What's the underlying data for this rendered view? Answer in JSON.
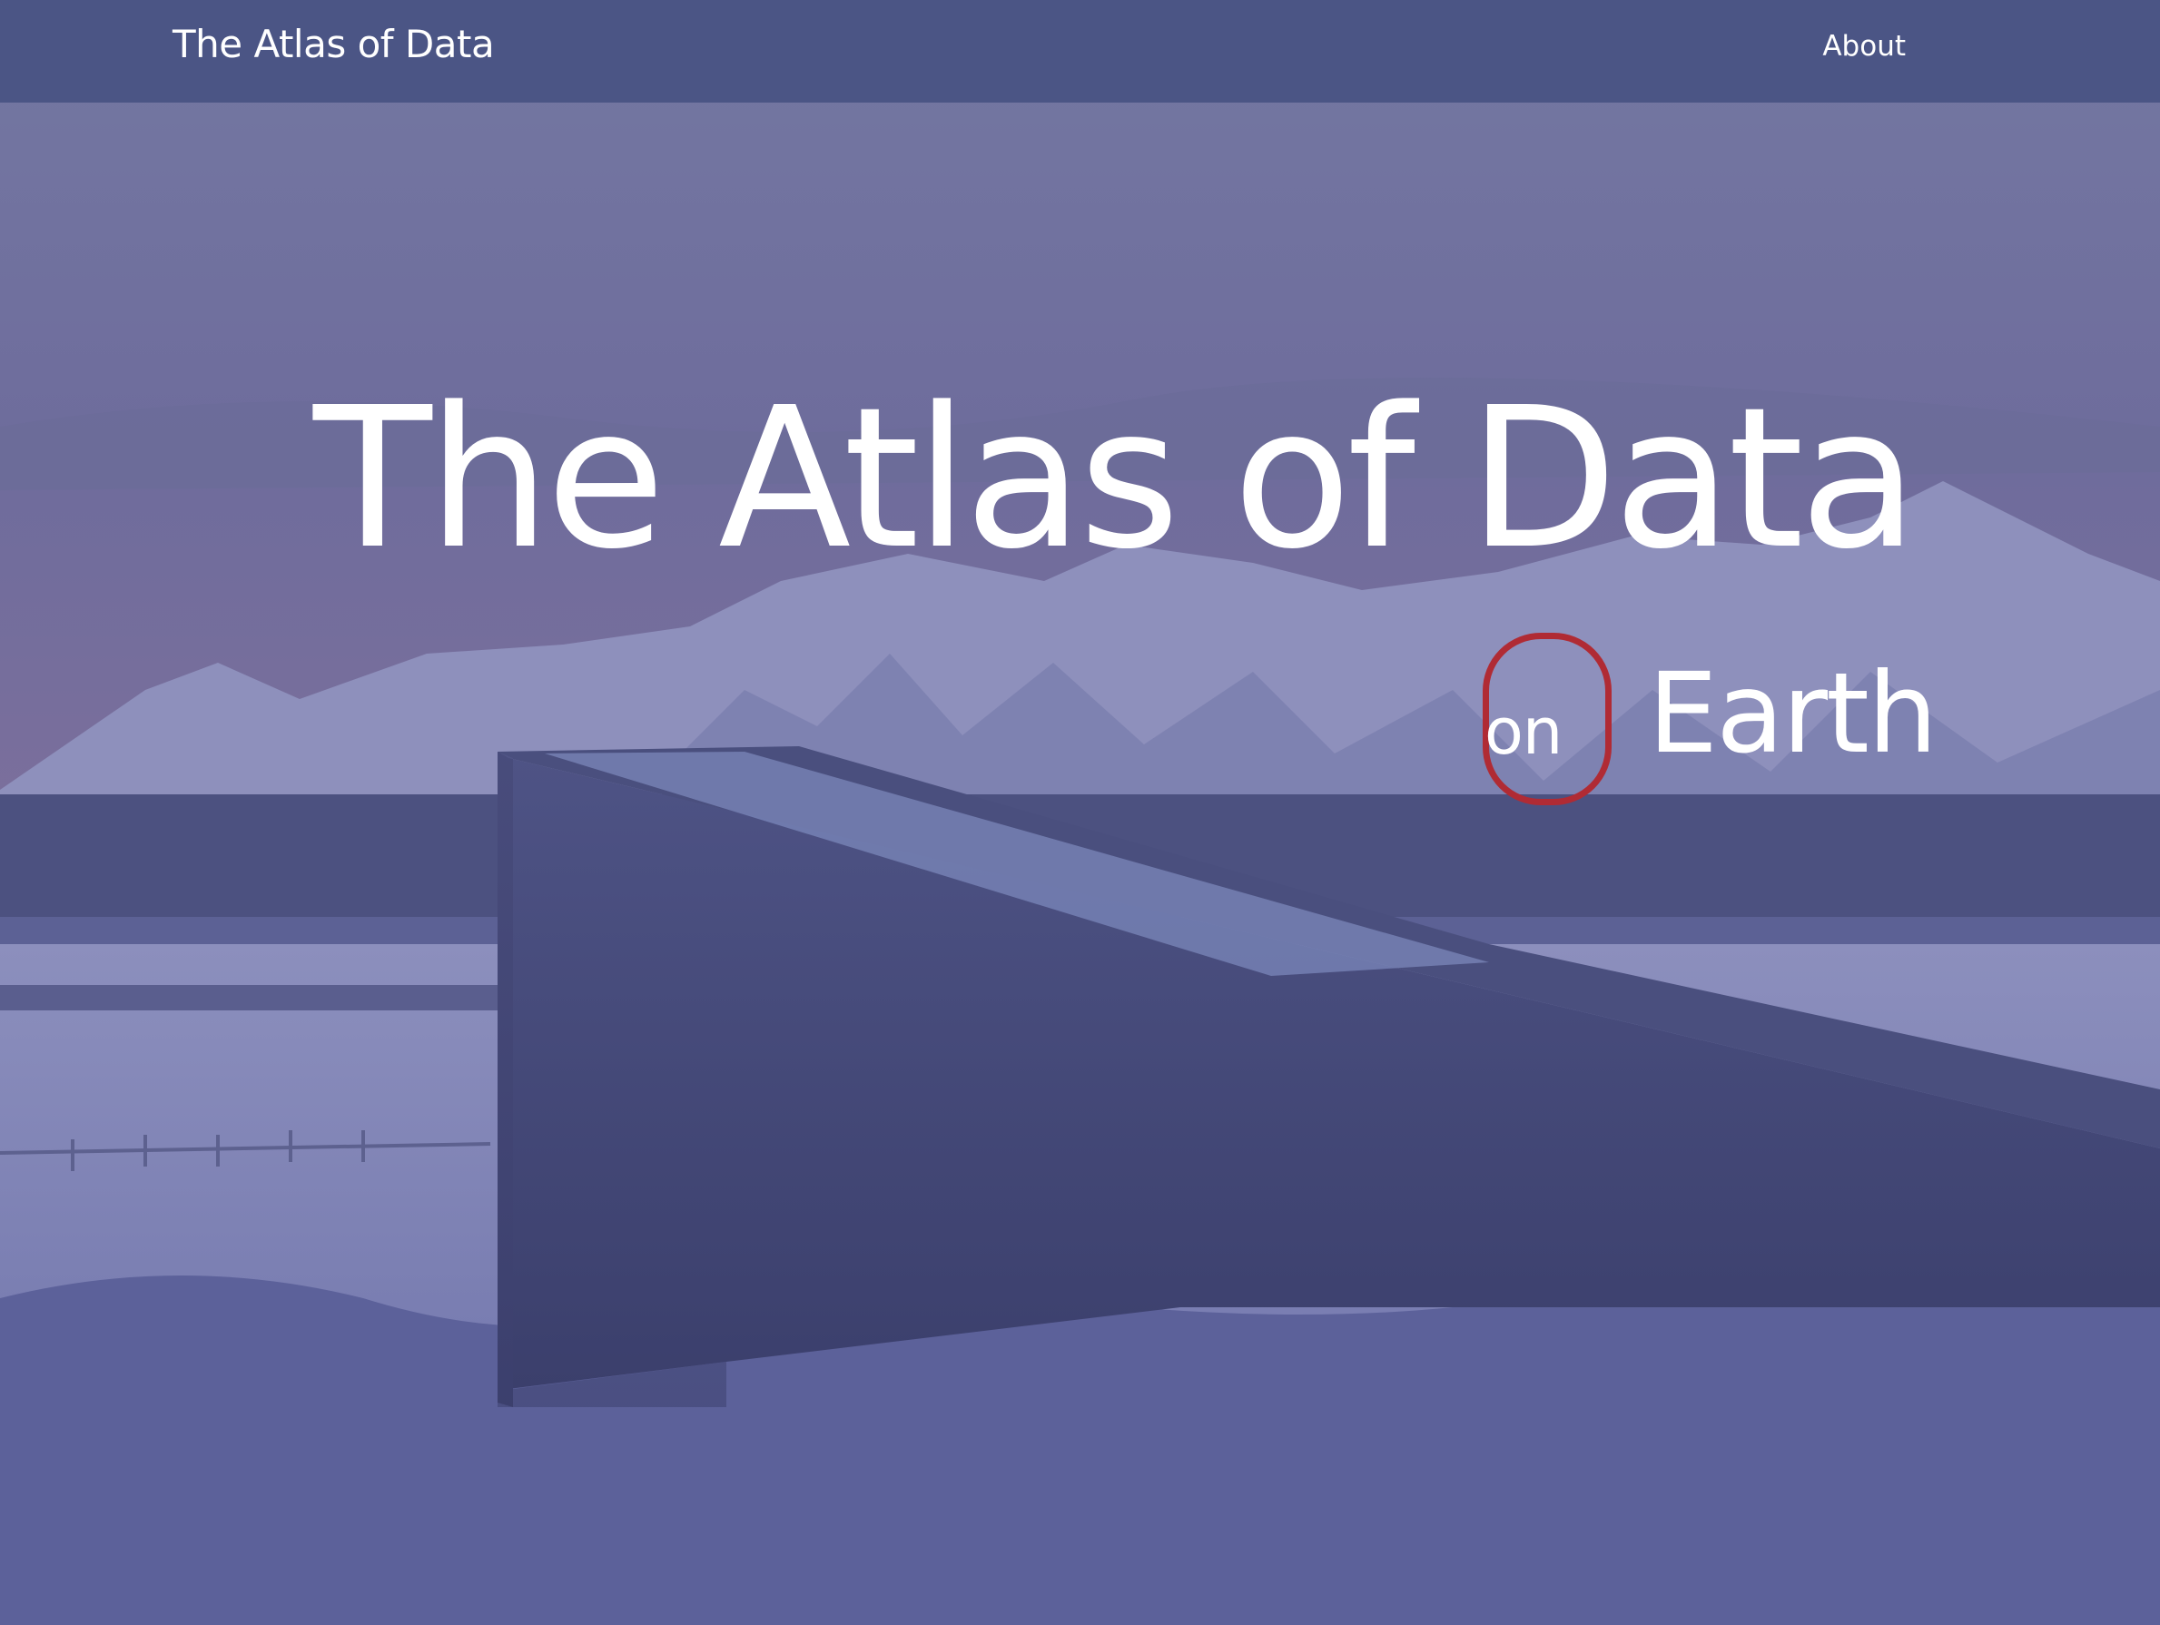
{
  "navbar": {
    "brand": "The Atlas of Data",
    "links": [
      {
        "label": "About"
      }
    ]
  },
  "hero": {
    "title": "The Atlas of Data",
    "subtitle_on": "on",
    "subtitle_rest": "Earth",
    "background": "Snow-covered concrete vault entrance in front of a fjord and snowy mountains, under a dusky sky"
  },
  "colors": {
    "navbar": "#4b5585",
    "overlay": "#4f5791",
    "highlight_ring": "#b02b34",
    "text": "#ffffff"
  }
}
